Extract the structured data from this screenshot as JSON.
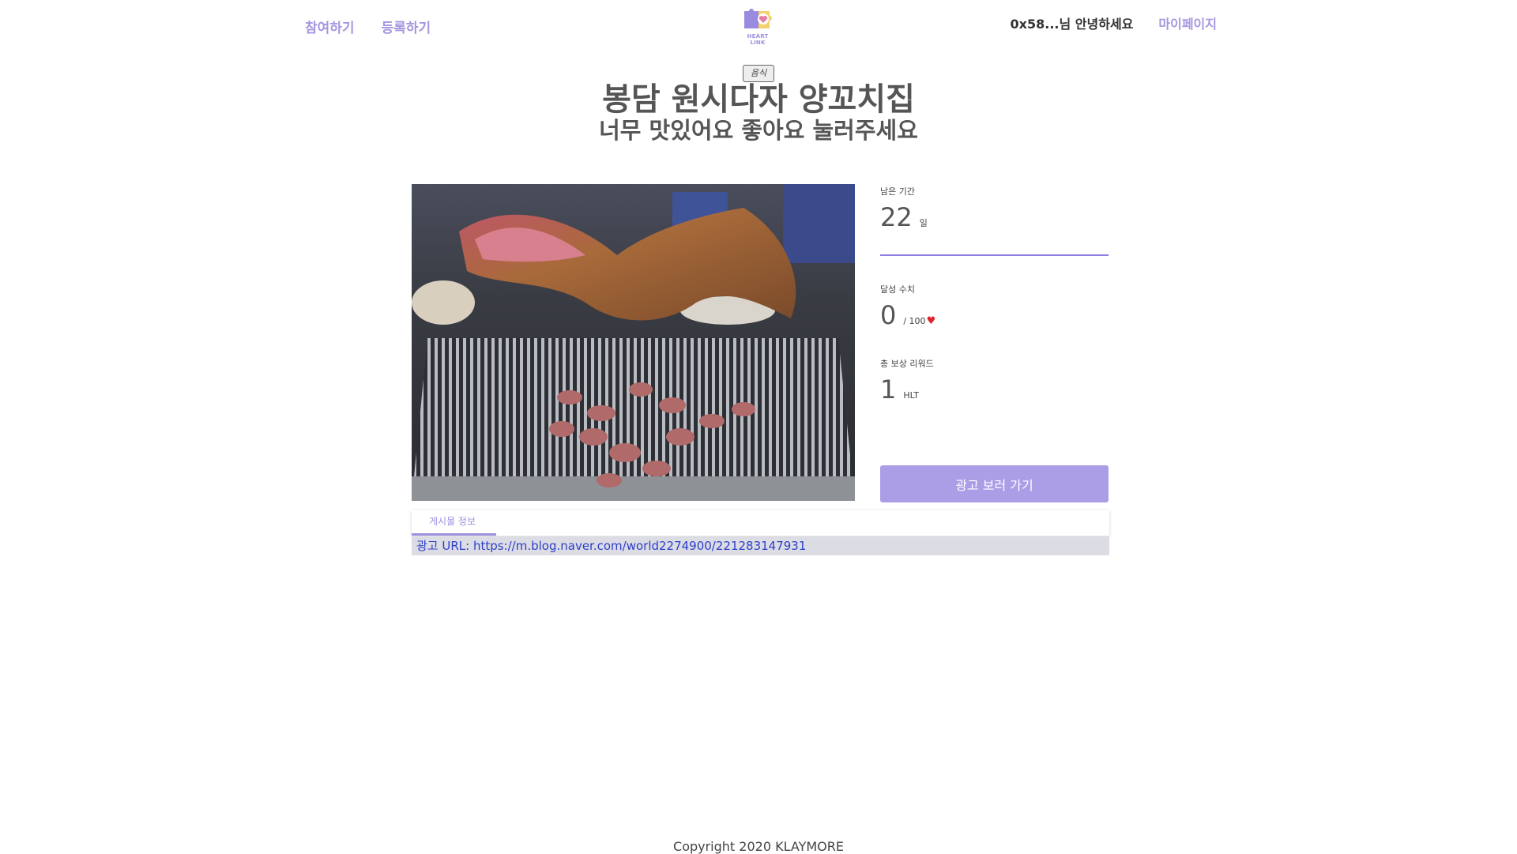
{
  "header": {
    "nav_left": [
      {
        "label": "참여하기"
      },
      {
        "label": "등록하기"
      }
    ],
    "logo_text": "HEART LINK",
    "greeting": "0x58...님 안녕하세요",
    "mypage_label": "마이페이지"
  },
  "post": {
    "category": "음식",
    "title": "봉담 원시다자 양꼬치집",
    "subtitle": "너무 맛있어요 좋아요 눌러주세요"
  },
  "stats": {
    "remaining": {
      "label": "남은 기간",
      "value": "22",
      "unit": "일"
    },
    "progress": {
      "label": "달성 수치",
      "value": "0",
      "unit": "/ 100"
    },
    "reward": {
      "label": "총 보상 리워드",
      "value": "1",
      "unit": "HLT"
    }
  },
  "ad_button_label": "광고 보러 가기",
  "info": {
    "tab_label": "게시물 정보",
    "url_text": "광고 URL: https://m.blog.naver.com/world2274900/221283147931"
  },
  "footer": {
    "copyright": "Copyright 2020 KLAYMORE"
  },
  "colors": {
    "accent": "#a796e0",
    "button": "#ab9de6",
    "link": "#2c3fc9",
    "heart": "#e0242b"
  }
}
